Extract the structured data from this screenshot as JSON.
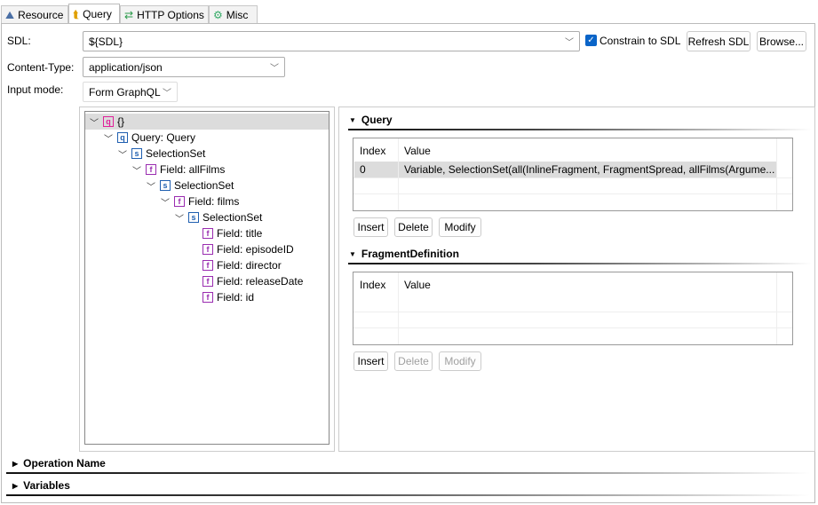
{
  "tabs": [
    {
      "label": "Resource",
      "icon": "resource-icon"
    },
    {
      "label": "Query",
      "icon": "query-icon",
      "active": true
    },
    {
      "label": "HTTP Options",
      "icon": "http-options-icon"
    },
    {
      "label": "Misc",
      "icon": "misc-icon"
    }
  ],
  "form": {
    "sdl_label": "SDL:",
    "sdl_value": "${SDL}",
    "constrain_label": "Constrain to SDL",
    "constrain_checked": true,
    "refresh_label": "Refresh SDL",
    "browse_label": "Browse...",
    "content_type_label": "Content-Type:",
    "content_type_value": "application/json",
    "input_mode_label": "Input mode:",
    "input_mode_value": "Form GraphQL"
  },
  "tree": [
    {
      "label": "{}",
      "icon": "q",
      "level": 0,
      "expanded": true,
      "selected": true
    },
    {
      "label": "Query: Query",
      "icon": "qq",
      "level": 1,
      "expanded": true
    },
    {
      "label": "SelectionSet",
      "icon": "s",
      "level": 2,
      "expanded": true
    },
    {
      "label": "Field: allFilms",
      "icon": "f",
      "level": 3,
      "expanded": true
    },
    {
      "label": "SelectionSet",
      "icon": "s",
      "level": 4,
      "expanded": true
    },
    {
      "label": "Field: films",
      "icon": "f",
      "level": 5,
      "expanded": true
    },
    {
      "label": "SelectionSet",
      "icon": "s",
      "level": 6,
      "expanded": true
    },
    {
      "label": "Field: title",
      "icon": "f",
      "level": 7
    },
    {
      "label": "Field: episodeID",
      "icon": "f",
      "level": 7
    },
    {
      "label": "Field: director",
      "icon": "f",
      "level": 7
    },
    {
      "label": "Field: releaseDate",
      "icon": "f",
      "level": 7
    },
    {
      "label": "Field: id",
      "icon": "f",
      "level": 7
    }
  ],
  "query_section": {
    "title": "Query",
    "columns": [
      "Index",
      "Value"
    ],
    "rows": [
      [
        "0",
        "Variable, SelectionSet(all(InlineFragment, FragmentSpread, allFilms(Argume..."
      ]
    ],
    "insert": "Insert",
    "delete": "Delete",
    "modify": "Modify"
  },
  "fragment_section": {
    "title": "FragmentDefinition",
    "columns": [
      "Index",
      "Value"
    ],
    "rows": [],
    "insert": "Insert",
    "delete": "Delete",
    "modify": "Modify"
  },
  "operation_name": "Operation Name",
  "variables": "Variables",
  "colors": {
    "accent": "#0a64c8",
    "selected_row": "#dcdcdc"
  }
}
